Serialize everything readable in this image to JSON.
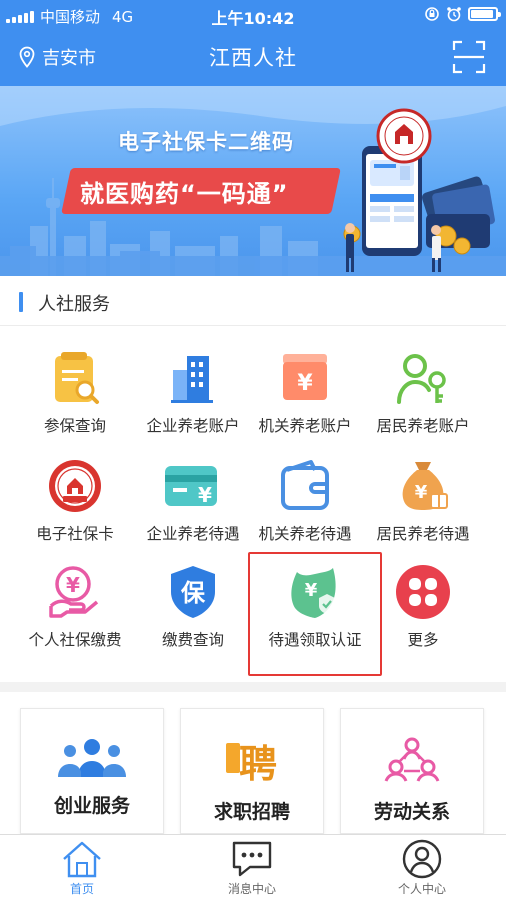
{
  "status_bar": {
    "carrier": "中国移动",
    "network": "4G",
    "time": "上午10:42"
  },
  "navbar": {
    "location": "吉安市",
    "title": "江西人社"
  },
  "banner": {
    "line1": "电子社保卡二维码",
    "line2": "就医购药“一码通”"
  },
  "section": {
    "title": "人社服务"
  },
  "services": [
    {
      "label": "参保查询",
      "icon": "clipboard-search-icon"
    },
    {
      "label": "企业养老账户",
      "icon": "buildings-icon"
    },
    {
      "label": "机关养老账户",
      "icon": "yuan-box-icon"
    },
    {
      "label": "居民养老账户",
      "icon": "person-key-icon"
    },
    {
      "label": "电子社保卡",
      "icon": "social-security-seal-icon"
    },
    {
      "label": "企业养老待遇",
      "icon": "yuan-card-icon"
    },
    {
      "label": "机关养老待遇",
      "icon": "wallet-icon"
    },
    {
      "label": "居民养老待遇",
      "icon": "money-bag-icon"
    },
    {
      "label": "个人社保缴费",
      "icon": "yuan-hand-icon"
    },
    {
      "label": "缴费查询",
      "icon": "shield-bao-icon",
      "glyph": "保"
    },
    {
      "label": "待遇领取认证",
      "icon": "yuan-check-shield-icon"
    },
    {
      "label": "更多",
      "icon": "more-grid-icon"
    }
  ],
  "cards": [
    {
      "label": "创业服务",
      "icon": "team-icon"
    },
    {
      "label": "求职招聘",
      "icon": "recruit-icon",
      "glyph": "聘"
    },
    {
      "label": "劳动关系",
      "icon": "relation-icon"
    }
  ],
  "tabbar": [
    {
      "label": "首页",
      "icon": "home-icon",
      "active": true
    },
    {
      "label": "消息中心",
      "icon": "message-icon",
      "active": false
    },
    {
      "label": "个人中心",
      "icon": "user-icon",
      "active": false
    }
  ],
  "colors": {
    "primary": "#3f8ff0",
    "highlight": "#e53935",
    "banner_red": "#e84a4a"
  }
}
